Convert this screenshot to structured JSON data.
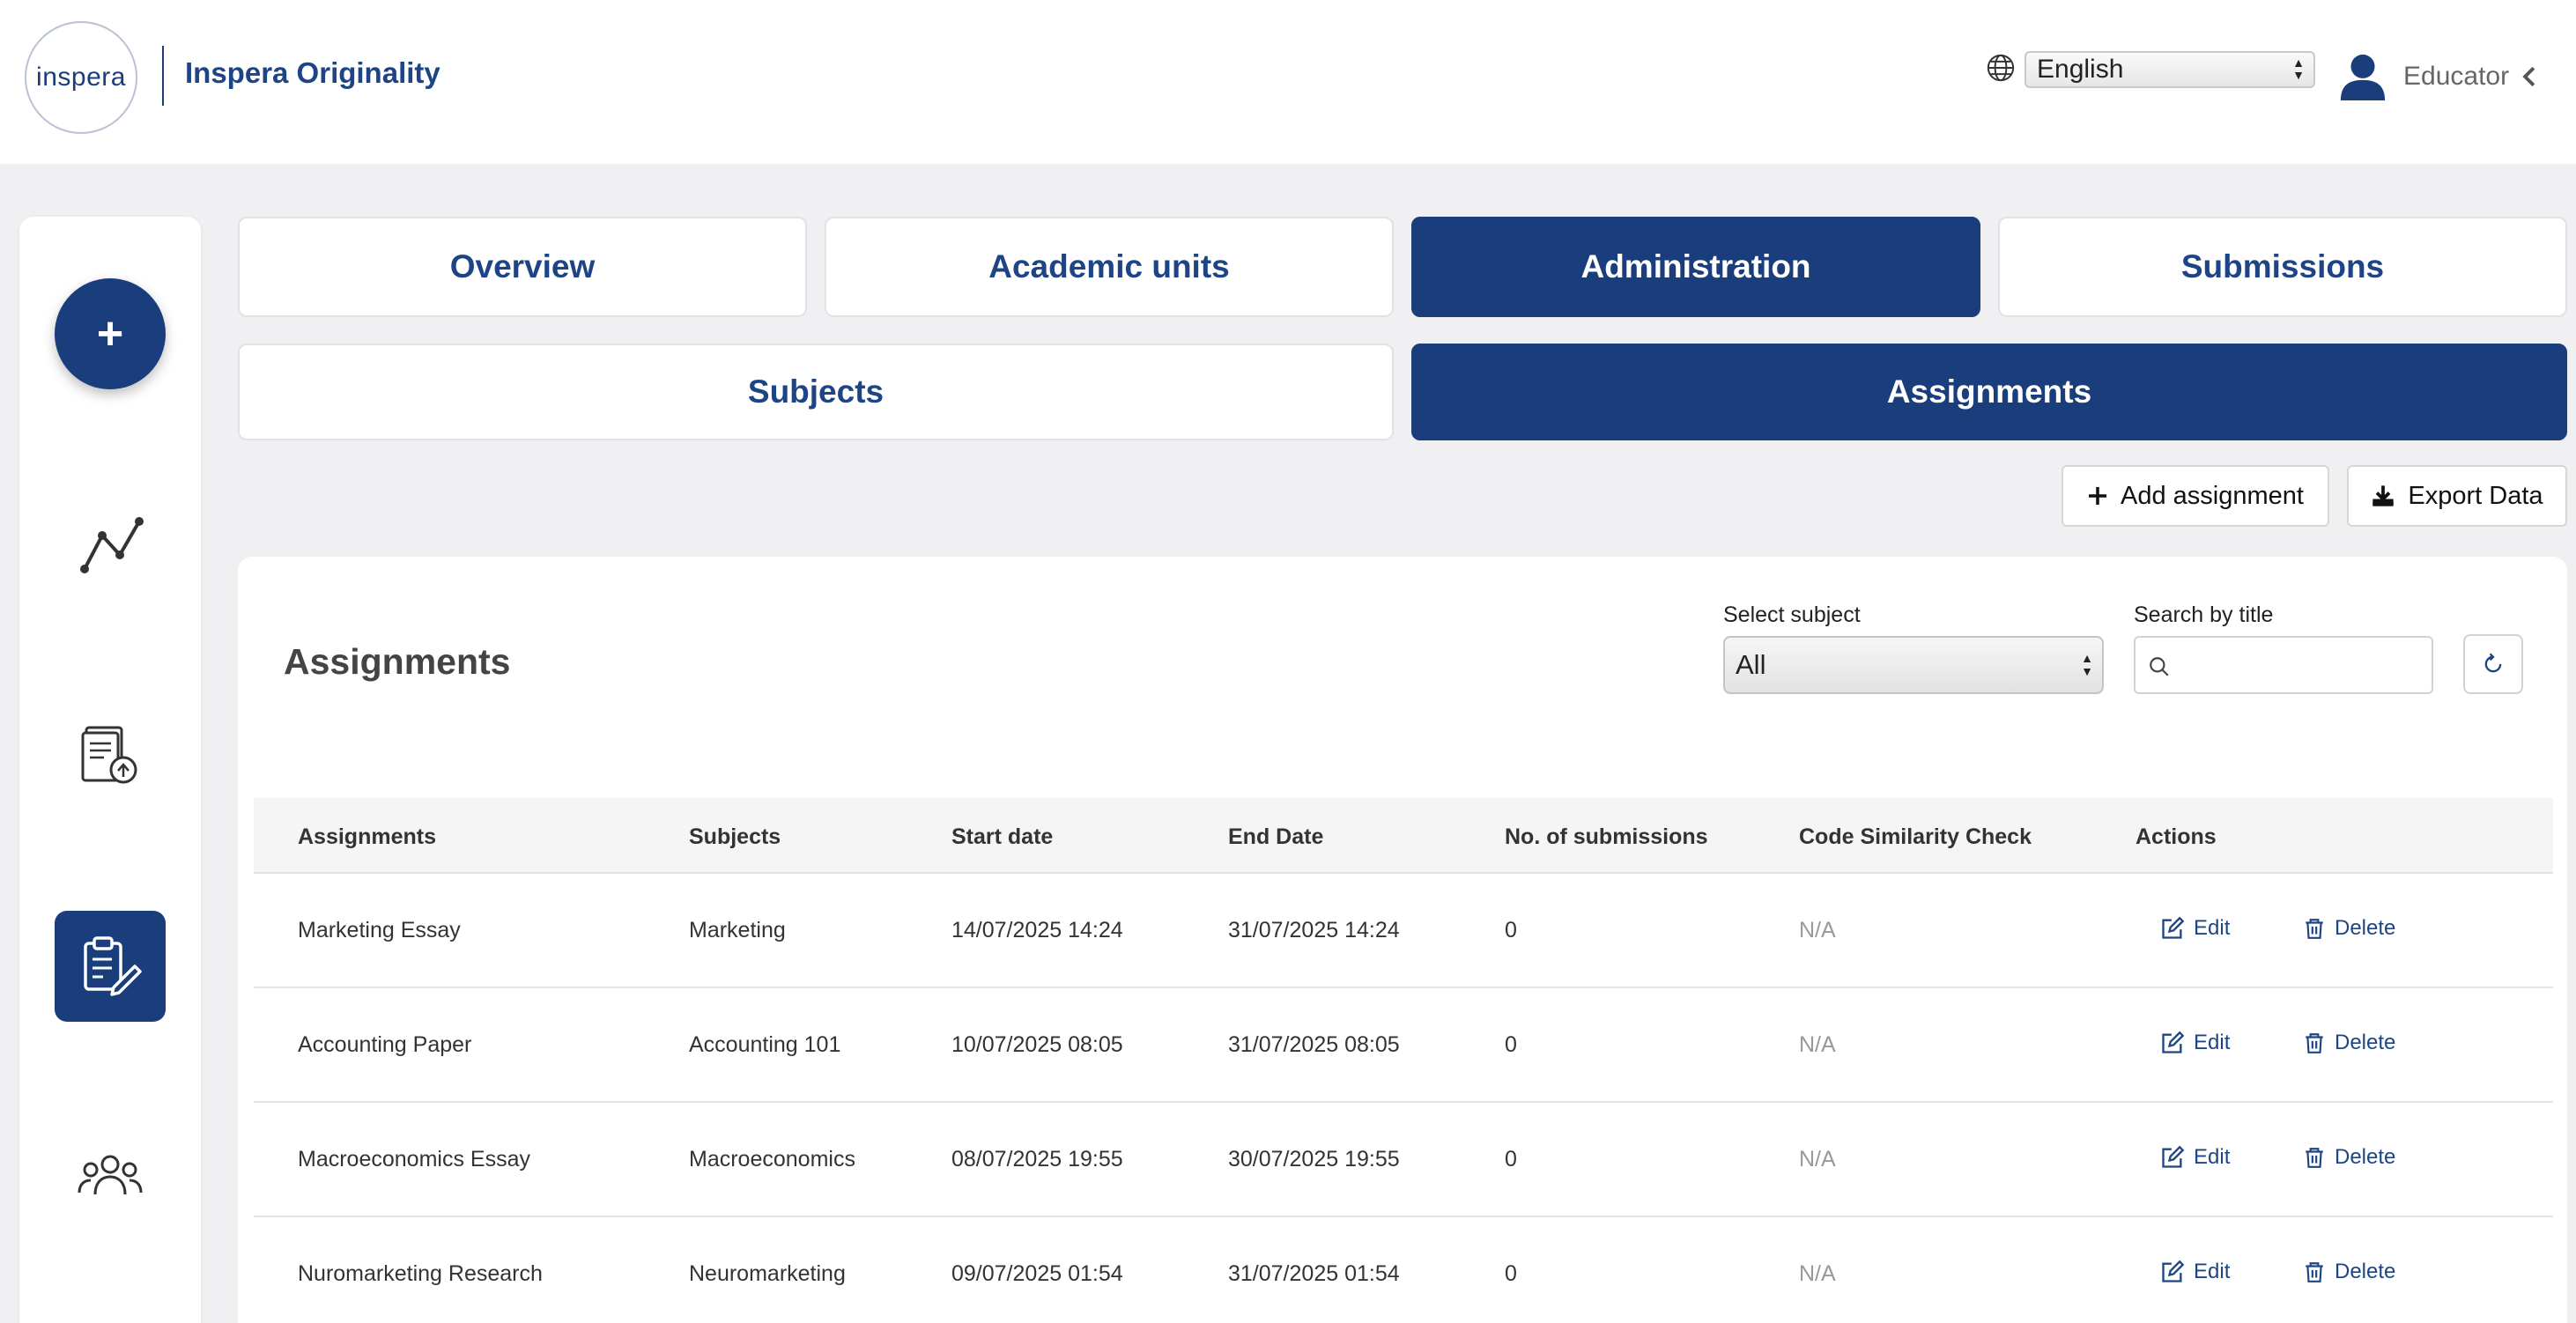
{
  "header": {
    "logo_text": "inspera",
    "brand": "Inspera Originality",
    "language": "English",
    "user_role": "Educator"
  },
  "icons": {
    "globe": "globe-icon",
    "user": "user-icon",
    "chevron": "chevron-left-icon",
    "plus": "plus-icon",
    "analytics": "analytics-line-icon",
    "document": "document-upload-icon",
    "clipboard": "clipboard-edit-icon",
    "users": "users-group-icon"
  },
  "colors": {
    "primary": "#1a3d7c",
    "background": "#f0f0f2"
  },
  "sidebar": {
    "add_label": "+"
  },
  "tabs": {
    "primary": [
      {
        "label": "Overview",
        "active": false
      },
      {
        "label": "Academic units",
        "active": false
      },
      {
        "label": "Administration",
        "active": true
      },
      {
        "label": "Submissions",
        "active": false
      }
    ],
    "secondary": [
      {
        "label": "Subjects",
        "active": false
      },
      {
        "label": "Assignments",
        "active": true
      }
    ]
  },
  "actions": {
    "add_assignment": "Add assignment",
    "export_data": "Export Data"
  },
  "card": {
    "title": "Assignments",
    "subject_label": "Select subject",
    "subject_value": "All",
    "search_label": "Search by title",
    "search_placeholder": ""
  },
  "table": {
    "columns": [
      "Assignments",
      "Subjects",
      "Start date",
      "End Date",
      "No. of submissions",
      "Code Similarity Check",
      "Actions"
    ],
    "edit_label": "Edit",
    "delete_label": "Delete",
    "rows": [
      {
        "assignment": "Marketing Essay",
        "subject": "Marketing",
        "start": "14/07/2025 14:24",
        "end": "31/07/2025 14:24",
        "submissions": "0",
        "code_check": "N/A"
      },
      {
        "assignment": "Accounting Paper",
        "subject": "Accounting 101",
        "start": "10/07/2025 08:05",
        "end": "31/07/2025 08:05",
        "submissions": "0",
        "code_check": "N/A"
      },
      {
        "assignment": "Macroeconomics Essay",
        "subject": "Macroeconomics",
        "start": "08/07/2025 19:55",
        "end": "30/07/2025 19:55",
        "submissions": "0",
        "code_check": "N/A"
      },
      {
        "assignment": "Nuromarketing Research",
        "subject": "Neuromarketing",
        "start": "09/07/2025 01:54",
        "end": "31/07/2025 01:54",
        "submissions": "0",
        "code_check": "N/A"
      }
    ]
  }
}
